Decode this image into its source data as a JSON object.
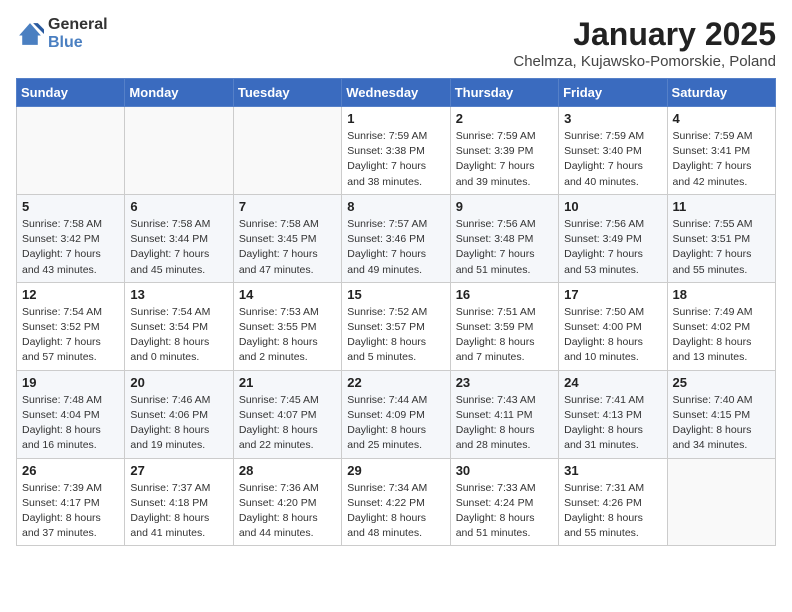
{
  "logo": {
    "general": "General",
    "blue": "Blue"
  },
  "title": "January 2025",
  "subtitle": "Chelmza, Kujawsko-Pomorskie, Poland",
  "days_header": [
    "Sunday",
    "Monday",
    "Tuesday",
    "Wednesday",
    "Thursday",
    "Friday",
    "Saturday"
  ],
  "weeks": [
    [
      {
        "day": "",
        "info": ""
      },
      {
        "day": "",
        "info": ""
      },
      {
        "day": "",
        "info": ""
      },
      {
        "day": "1",
        "info": "Sunrise: 7:59 AM\nSunset: 3:38 PM\nDaylight: 7 hours\nand 38 minutes."
      },
      {
        "day": "2",
        "info": "Sunrise: 7:59 AM\nSunset: 3:39 PM\nDaylight: 7 hours\nand 39 minutes."
      },
      {
        "day": "3",
        "info": "Sunrise: 7:59 AM\nSunset: 3:40 PM\nDaylight: 7 hours\nand 40 minutes."
      },
      {
        "day": "4",
        "info": "Sunrise: 7:59 AM\nSunset: 3:41 PM\nDaylight: 7 hours\nand 42 minutes."
      }
    ],
    [
      {
        "day": "5",
        "info": "Sunrise: 7:58 AM\nSunset: 3:42 PM\nDaylight: 7 hours\nand 43 minutes."
      },
      {
        "day": "6",
        "info": "Sunrise: 7:58 AM\nSunset: 3:44 PM\nDaylight: 7 hours\nand 45 minutes."
      },
      {
        "day": "7",
        "info": "Sunrise: 7:58 AM\nSunset: 3:45 PM\nDaylight: 7 hours\nand 47 minutes."
      },
      {
        "day": "8",
        "info": "Sunrise: 7:57 AM\nSunset: 3:46 PM\nDaylight: 7 hours\nand 49 minutes."
      },
      {
        "day": "9",
        "info": "Sunrise: 7:56 AM\nSunset: 3:48 PM\nDaylight: 7 hours\nand 51 minutes."
      },
      {
        "day": "10",
        "info": "Sunrise: 7:56 AM\nSunset: 3:49 PM\nDaylight: 7 hours\nand 53 minutes."
      },
      {
        "day": "11",
        "info": "Sunrise: 7:55 AM\nSunset: 3:51 PM\nDaylight: 7 hours\nand 55 minutes."
      }
    ],
    [
      {
        "day": "12",
        "info": "Sunrise: 7:54 AM\nSunset: 3:52 PM\nDaylight: 7 hours\nand 57 minutes."
      },
      {
        "day": "13",
        "info": "Sunrise: 7:54 AM\nSunset: 3:54 PM\nDaylight: 8 hours\nand 0 minutes."
      },
      {
        "day": "14",
        "info": "Sunrise: 7:53 AM\nSunset: 3:55 PM\nDaylight: 8 hours\nand 2 minutes."
      },
      {
        "day": "15",
        "info": "Sunrise: 7:52 AM\nSunset: 3:57 PM\nDaylight: 8 hours\nand 5 minutes."
      },
      {
        "day": "16",
        "info": "Sunrise: 7:51 AM\nSunset: 3:59 PM\nDaylight: 8 hours\nand 7 minutes."
      },
      {
        "day": "17",
        "info": "Sunrise: 7:50 AM\nSunset: 4:00 PM\nDaylight: 8 hours\nand 10 minutes."
      },
      {
        "day": "18",
        "info": "Sunrise: 7:49 AM\nSunset: 4:02 PM\nDaylight: 8 hours\nand 13 minutes."
      }
    ],
    [
      {
        "day": "19",
        "info": "Sunrise: 7:48 AM\nSunset: 4:04 PM\nDaylight: 8 hours\nand 16 minutes."
      },
      {
        "day": "20",
        "info": "Sunrise: 7:46 AM\nSunset: 4:06 PM\nDaylight: 8 hours\nand 19 minutes."
      },
      {
        "day": "21",
        "info": "Sunrise: 7:45 AM\nSunset: 4:07 PM\nDaylight: 8 hours\nand 22 minutes."
      },
      {
        "day": "22",
        "info": "Sunrise: 7:44 AM\nSunset: 4:09 PM\nDaylight: 8 hours\nand 25 minutes."
      },
      {
        "day": "23",
        "info": "Sunrise: 7:43 AM\nSunset: 4:11 PM\nDaylight: 8 hours\nand 28 minutes."
      },
      {
        "day": "24",
        "info": "Sunrise: 7:41 AM\nSunset: 4:13 PM\nDaylight: 8 hours\nand 31 minutes."
      },
      {
        "day": "25",
        "info": "Sunrise: 7:40 AM\nSunset: 4:15 PM\nDaylight: 8 hours\nand 34 minutes."
      }
    ],
    [
      {
        "day": "26",
        "info": "Sunrise: 7:39 AM\nSunset: 4:17 PM\nDaylight: 8 hours\nand 37 minutes."
      },
      {
        "day": "27",
        "info": "Sunrise: 7:37 AM\nSunset: 4:18 PM\nDaylight: 8 hours\nand 41 minutes."
      },
      {
        "day": "28",
        "info": "Sunrise: 7:36 AM\nSunset: 4:20 PM\nDaylight: 8 hours\nand 44 minutes."
      },
      {
        "day": "29",
        "info": "Sunrise: 7:34 AM\nSunset: 4:22 PM\nDaylight: 8 hours\nand 48 minutes."
      },
      {
        "day": "30",
        "info": "Sunrise: 7:33 AM\nSunset: 4:24 PM\nDaylight: 8 hours\nand 51 minutes."
      },
      {
        "day": "31",
        "info": "Sunrise: 7:31 AM\nSunset: 4:26 PM\nDaylight: 8 hours\nand 55 minutes."
      },
      {
        "day": "",
        "info": ""
      }
    ]
  ]
}
